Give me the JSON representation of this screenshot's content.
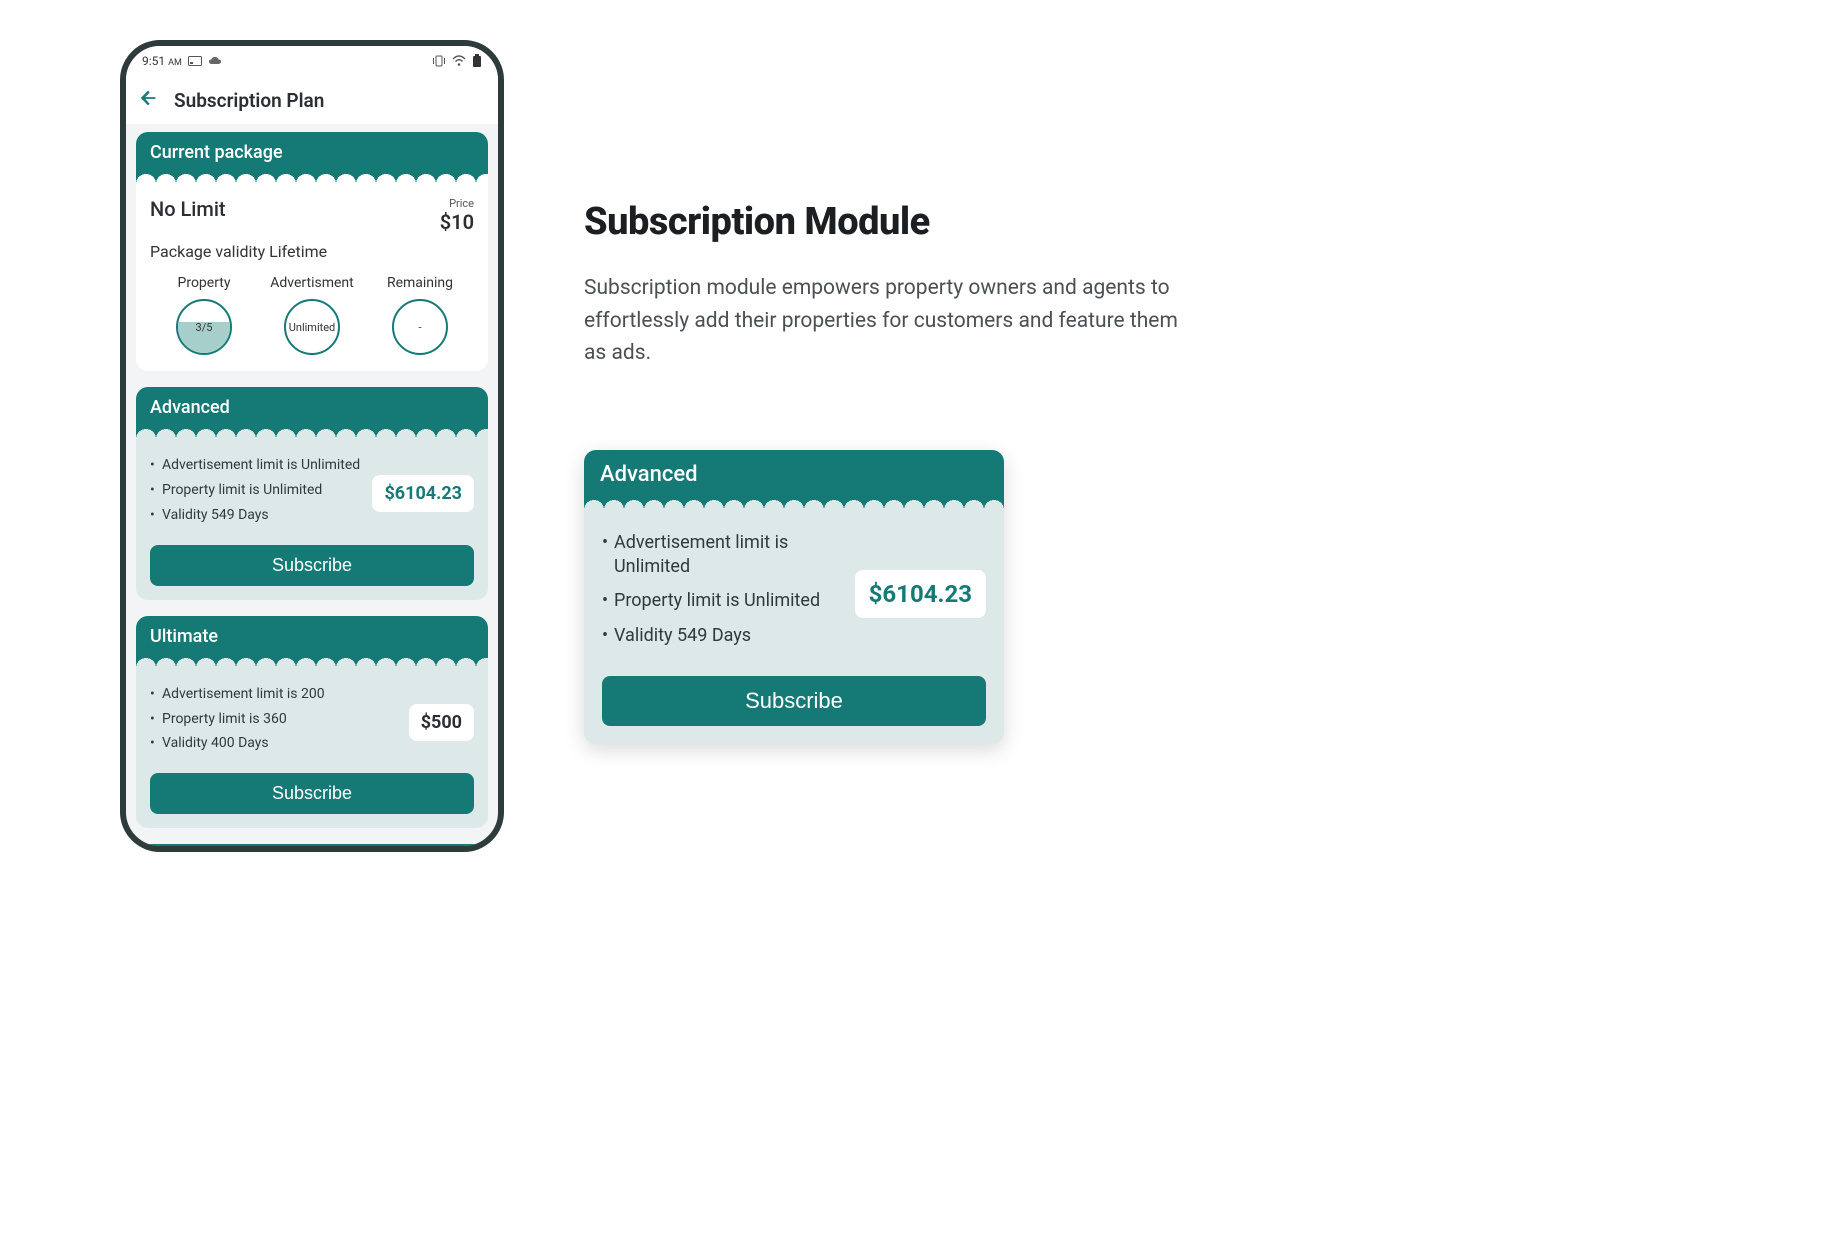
{
  "statusbar": {
    "time": "9:51",
    "ampm": "AM"
  },
  "appbar": {
    "title": "Subscription Plan"
  },
  "current_package": {
    "header": "Current package",
    "name": "No Limit",
    "price_label": "Price",
    "price": "$10",
    "validity_text": "Package validity Lifetime",
    "stats": {
      "property": {
        "label": "Property",
        "value": "3/5",
        "fill_pct": 60
      },
      "advertisement": {
        "label": "Advertisment",
        "value": "Unlimited"
      },
      "remaining": {
        "label": "Remaining",
        "value": "-"
      }
    }
  },
  "plans": [
    {
      "name": "Advanced",
      "features": [
        "Advertisement limit is Unlimited",
        "Property limit  is Unlimited",
        "Validity 549 Days"
      ],
      "price": "$6104.23",
      "cta": "Subscribe"
    },
    {
      "name": "Ultimate",
      "features": [
        "Advertisement limit is 200",
        "Property limit  is 360",
        "Validity 400 Days"
      ],
      "price": "$500",
      "cta": "Subscribe"
    }
  ],
  "marketing": {
    "headline": "Subscription Module",
    "description": "Subscription module empowers property owners and agents to effortlessly add their properties for customers and feature them as ads."
  },
  "detached_card": {
    "name": "Advanced",
    "features": [
      "Advertisement limit is Unlimited",
      "Property limit  is Unlimited",
      "Validity 549 Days"
    ],
    "price": "$6104.23",
    "cta": "Subscribe"
  }
}
